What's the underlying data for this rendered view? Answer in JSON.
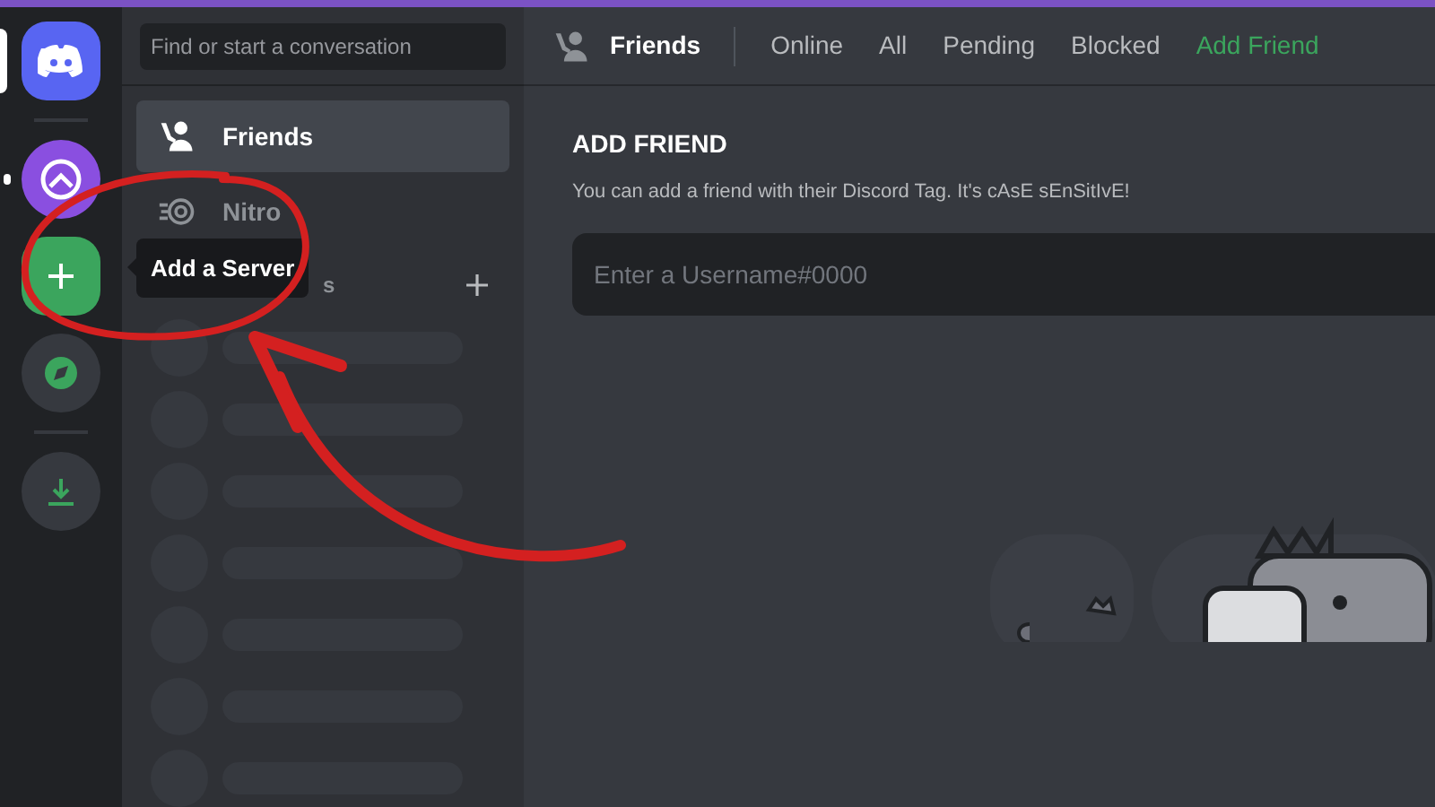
{
  "search": {
    "placeholder": "Find or start a conversation"
  },
  "nav_items": [
    {
      "label": "Friends",
      "kind": "friends",
      "selected": true
    },
    {
      "label": "Nitro",
      "kind": "nitro",
      "selected": false
    }
  ],
  "dm_header": {
    "label": "s"
  },
  "tooltip": "Add a Server",
  "header_title": "Friends",
  "tabs": [
    {
      "label": "Online",
      "selected": false
    },
    {
      "label": "All",
      "selected": false
    },
    {
      "label": "Pending",
      "selected": false
    },
    {
      "label": "Blocked",
      "selected": false
    },
    {
      "label": "Add Friend",
      "selected": true
    }
  ],
  "add_friend": {
    "title": "ADD FRIEND",
    "description": "You can add a friend with their Discord Tag. It's cAsE sEnSitIvE!",
    "placeholder": "Enter a Username#0000"
  }
}
